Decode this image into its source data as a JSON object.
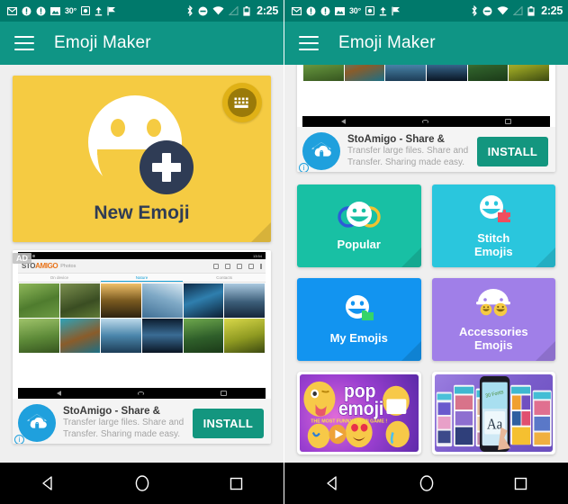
{
  "app": {
    "title": "Emoji Maker",
    "accent_color": "#0f9585",
    "statusbar_color": "#00796b"
  },
  "statusbar": {
    "temperature": "30°",
    "time": "2:25",
    "icons_left": [
      "gmail-icon",
      "info-circle-icon",
      "info-circle-icon",
      "photo-icon",
      "camera-icon",
      "upload-icon",
      "flag-icon"
    ],
    "icons_right": [
      "bluetooth-icon",
      "do-not-disturb-icon",
      "wifi-icon",
      "signal-off-icon",
      "battery-icon"
    ]
  },
  "left_screen": {
    "new_emoji_card": {
      "label": "New Emoji",
      "background_color": "#f5cb42",
      "text_color": "#2f3c55",
      "badge_icon": "keyboard-icon"
    },
    "ad": {
      "badge": "AD",
      "title": "StoAmigo - Share &",
      "description_line1": "Transfer large files. Share and",
      "description_line2": "Transfer. Sharing made easy.",
      "install_label": "INSTALL",
      "install_color": "#13967f",
      "icon": "cloud-lock-icon",
      "info_glyph": "i",
      "screenshot": {
        "app_logo_1": "STO",
        "app_logo_2": "AMIGO",
        "app_logo_3": "Photos",
        "tabs": [
          "On device",
          "Nature",
          "Contacts"
        ],
        "active_tab": "Nature"
      }
    }
  },
  "right_screen": {
    "ad": {
      "title": "StoAmigo - Share &",
      "description_line1": "Transfer large files. Share and",
      "description_line2": "Transfer. Sharing made easy.",
      "install_label": "INSTALL",
      "install_color": "#13967f",
      "icon": "cloud-lock-icon",
      "info_glyph": "i"
    },
    "tiles": [
      {
        "label": "Popular",
        "color": "#18c0a4",
        "icon": "popular-faces-icon"
      },
      {
        "label": "Stitch\nEmojis",
        "label_line1": "Stitch",
        "label_line2": "Emojis",
        "color": "#2ac6dd",
        "icon": "stitch-puzzle-icon"
      },
      {
        "label": "My Emojis",
        "color": "#1294f0",
        "icon": "my-folder-icon"
      },
      {
        "label": "Accessories\nEmojis",
        "label_line1": "Accessories",
        "label_line2": "Emojis",
        "color": "#a07fe8",
        "icon": "accessories-icon"
      }
    ],
    "promos": [
      {
        "name": "pop-emoji-promo",
        "title_line1": "pop",
        "title_line2": "emoji",
        "tagline": "THE MOST FUNNY EMOJI GAME !"
      },
      {
        "name": "font-keyboard-promo",
        "phone_text": "Aa",
        "phone_caption": "30 Fonts"
      }
    ]
  },
  "navbar": {
    "back_label": "back-button",
    "home_label": "home-button",
    "recents_label": "recents-button"
  }
}
